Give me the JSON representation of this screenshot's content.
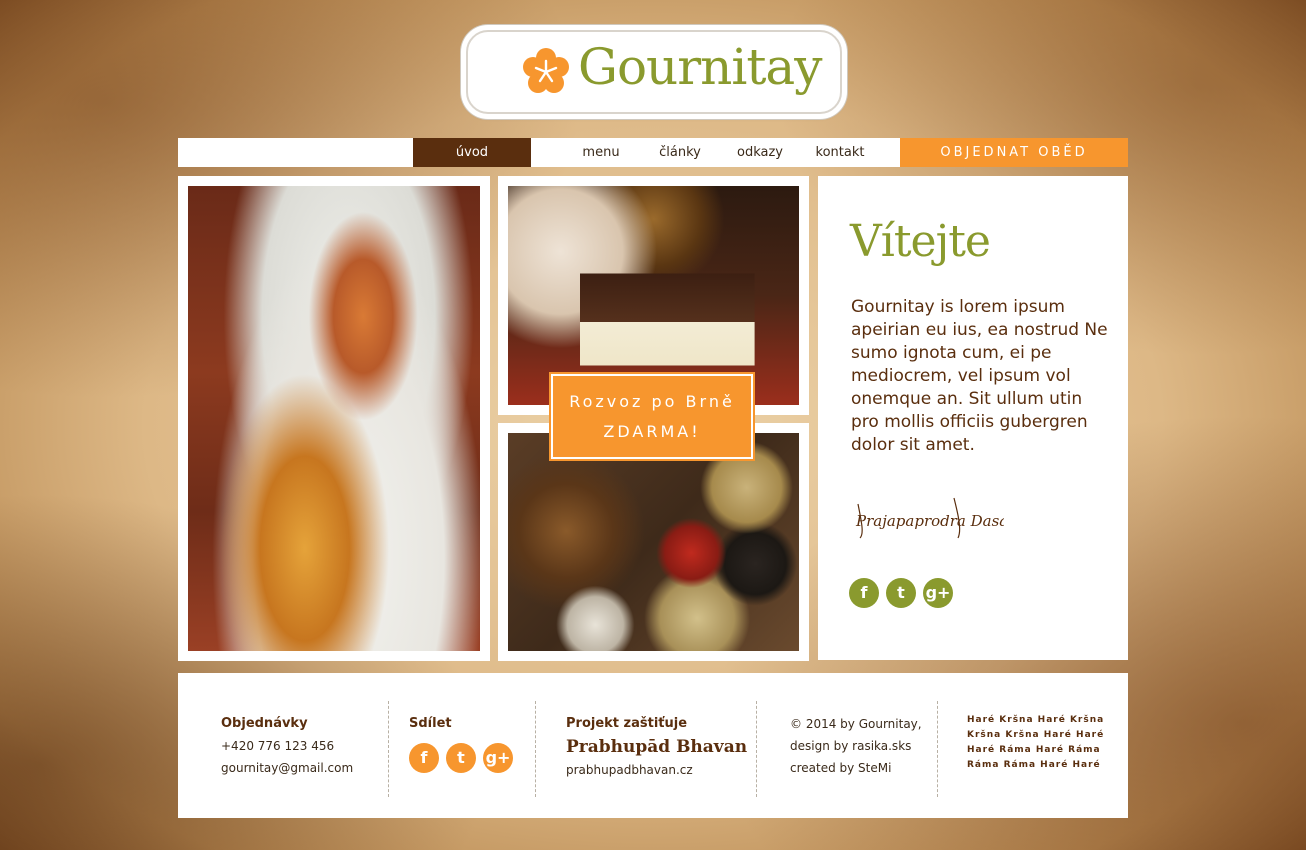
{
  "brand": {
    "name": "Gournitay"
  },
  "nav": {
    "items": [
      "úvod",
      "menu",
      "články",
      "odkazy",
      "kontakt"
    ],
    "active": "úvod",
    "cta": "OBJEDNAT OBĚD"
  },
  "promo": {
    "line1": "Rozvoz po Brně",
    "line2": "ZDARMA!"
  },
  "welcome": {
    "title": "Vítejte",
    "text": "Gournitay is lorem ipsum apeirian eu ius, ea nostrud Ne sumo ignota cum, ei pe mediocrem, vel ipsum vol onemque an. Sit ullum utin pro mollis officiis gubergren dolor sit amet.",
    "signature": "Prajapaprodra Dasa"
  },
  "social": {
    "facebook": "f",
    "twitter": "t",
    "google": "g+"
  },
  "footer": {
    "orders": {
      "heading": "Objednávky",
      "phone": "+420 776 123 456",
      "email": "gournitay@gmail.com"
    },
    "share": {
      "heading": "Sdílet"
    },
    "project": {
      "heading": "Projekt zaštiťuje",
      "name": "Prabhupād Bhavan",
      "url": "prabhupadbhavan.cz"
    },
    "credits": {
      "line1": "© 2014 by Gournitay,",
      "line2": "design by rasika.sks",
      "line3": "created by SteMi"
    },
    "mantra": [
      "Haré Kršna Haré Kršna",
      "Kršna Kršna Haré Haré",
      "Haré Ráma Haré Ráma",
      "Ráma Ráma Haré Haré"
    ]
  },
  "colors": {
    "olive": "#8a9a2e",
    "orange": "#f7962e",
    "brown": "#5a2e0e"
  },
  "icons": [
    "flower-logo-icon",
    "facebook-icon",
    "twitter-icon",
    "google-plus-icon"
  ]
}
